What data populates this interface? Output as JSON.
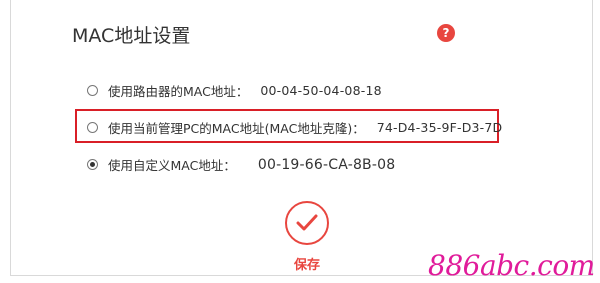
{
  "page": {
    "title": "MAC地址设置",
    "help_icon": "question-icon",
    "accent": "#e8463f"
  },
  "options": [
    {
      "label": "使用路由器的MAC地址：",
      "value": "00-04-50-04-08-18",
      "checked": false
    },
    {
      "label": "使用当前管理PC的MAC地址(MAC地址克隆)：",
      "value": "74-D4-35-9F-D3-7D",
      "checked": false
    },
    {
      "label": "使用自定义MAC地址：",
      "value": "00-19-66-CA-8B-08",
      "checked": true
    }
  ],
  "save": {
    "label": "保存",
    "icon": "check-icon"
  },
  "watermark": {
    "text": "886abc.com",
    "color": "#e01b9a"
  }
}
